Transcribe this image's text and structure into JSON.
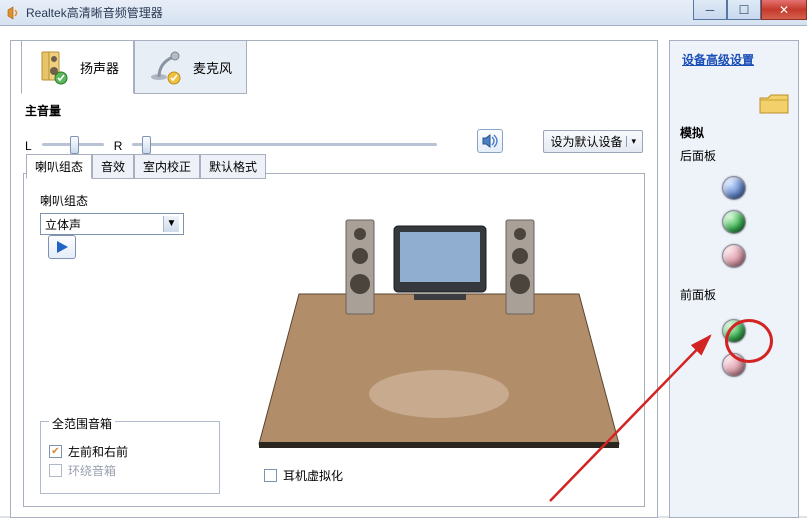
{
  "window": {
    "title": "Realtek高清晰音频管理器"
  },
  "tabs": {
    "speakers": "扬声器",
    "microphone": "麦克风"
  },
  "volume": {
    "title": "主音量",
    "left_label": "L",
    "right_label": "R",
    "default_button": "设为默认设备"
  },
  "inner_tabs": {
    "config": "喇叭组态",
    "effects": "音效",
    "room": "室内校正",
    "format": "默认格式"
  },
  "config": {
    "label": "喇叭组态",
    "selected": "立体声"
  },
  "full_range": {
    "title": "全范围音箱",
    "front": "左前和右前",
    "surround": "环绕音箱"
  },
  "headphone_virt": "耳机虚拟化",
  "side": {
    "advanced_link": "设备高级设置",
    "analog_title": "模拟",
    "rear_label": "后面板",
    "front_label": "前面板"
  }
}
